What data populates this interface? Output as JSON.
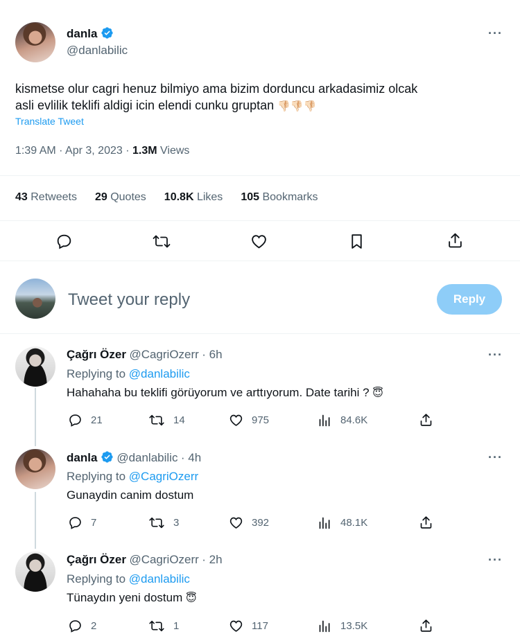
{
  "main_tweet": {
    "author_name": "danla",
    "author_handle": "@danlabilic",
    "text_line1": "kismetse olur cagri henuz bilmiyo ama bizim dorduncu arkadasimiz olcak",
    "text_line2": "asli evlilik teklifi aldigi icin elendi cunku gruptan",
    "text_emoji": "👎🏻👎🏻👎🏻",
    "translate_label": "Translate Tweet",
    "time": "1:39 AM",
    "date": "Apr 3, 2023",
    "views_count": "1.3M",
    "views_label": "Views",
    "stats": {
      "retweets_count": "43",
      "retweets_label": "Retweets",
      "quotes_count": "29",
      "quotes_label": "Quotes",
      "likes_count": "10.8K",
      "likes_label": "Likes",
      "bookmarks_count": "105",
      "bookmarks_label": "Bookmarks"
    },
    "more_label": "···"
  },
  "composer": {
    "placeholder": "Tweet your reply",
    "reply_button": "Reply"
  },
  "replies": [
    {
      "name": "Çağrı Özer",
      "handle": "@CagriOzerr",
      "time": "· 6h",
      "replying_prefix": "Replying to",
      "replying_to": "@danlabilic",
      "text": "Hahahaha bu teklifi görüyorum ve arttıyorum. Date tarihi ?",
      "emoji": "😇",
      "replies": "21",
      "retweets": "14",
      "likes": "975",
      "views": "84.6K"
    },
    {
      "name": "danla",
      "handle": "@danlabilic",
      "time": "· 4h",
      "replying_prefix": "Replying to",
      "replying_to": "@CagriOzerr",
      "text": "Gunaydin canim dostum",
      "emoji": "",
      "replies": "7",
      "retweets": "3",
      "likes": "392",
      "views": "48.1K"
    },
    {
      "name": "Çağrı Özer",
      "handle": "@CagriOzerr",
      "time": "· 2h",
      "replying_prefix": "Replying to",
      "replying_to": "@danlabilic",
      "text": "Tünaydın yeni dostum",
      "emoji": "😇",
      "replies": "2",
      "retweets": "1",
      "likes": "117",
      "views": "13.5K"
    }
  ],
  "colors": {
    "accent": "#1d9bf0",
    "muted": "#536471",
    "reply_button_disabled": "#8ecdf8"
  }
}
